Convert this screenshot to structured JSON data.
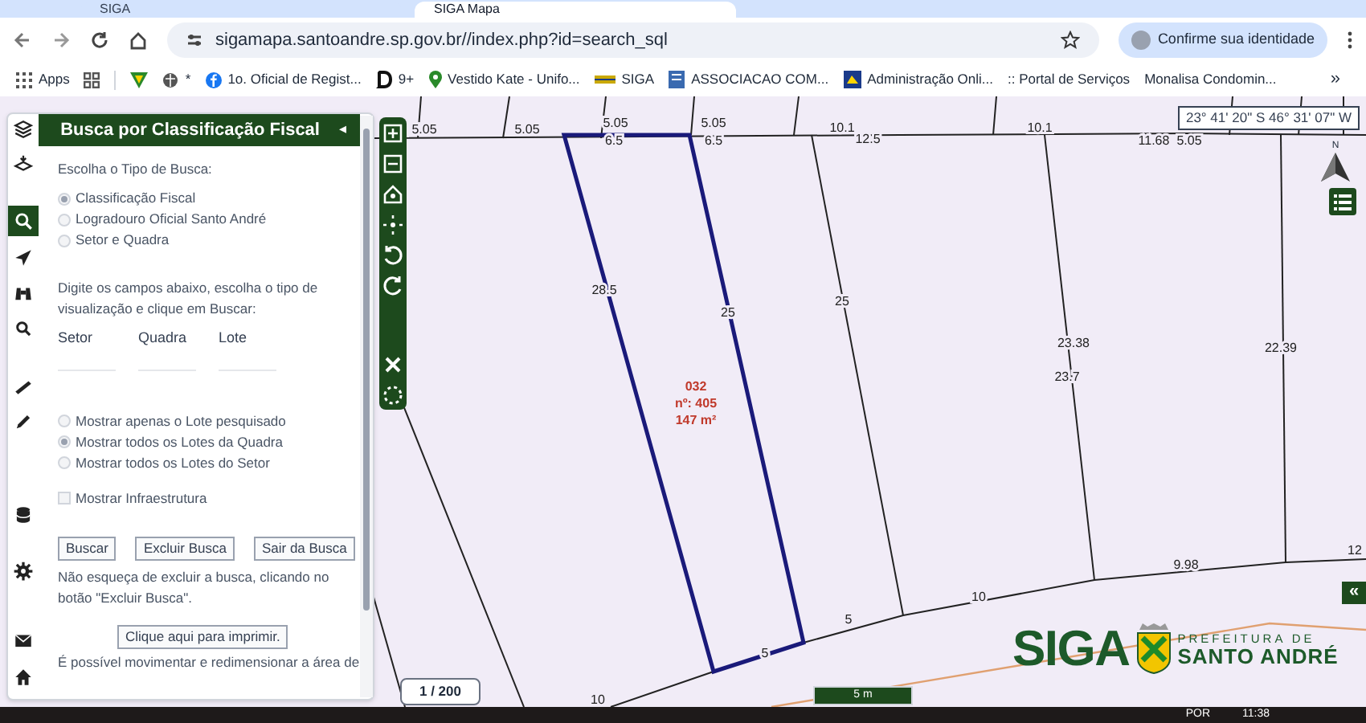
{
  "browser": {
    "tabs": [
      {
        "label": "SIGA",
        "selected": false
      },
      {
        "label": "SIGA Mapa",
        "selected": true
      }
    ],
    "url": "sigamapa.santoandre.sp.gov.br//index.php?id=search_sql",
    "profile_button": "Confirme sua identidade",
    "bookmarks": [
      {
        "label": "Apps"
      },
      {
        "label": "*"
      },
      {
        "label": "1o. Oficial de Regist..."
      },
      {
        "label": "9+"
      },
      {
        "label": "Vestido Kate - Unifo..."
      },
      {
        "label": "SIGA"
      },
      {
        "label": "ASSOCIACAO COM..."
      },
      {
        "label": "Administração Onli..."
      },
      {
        "label": ":: Portal de Serviços"
      },
      {
        "label": "Monalisa Condomin..."
      }
    ],
    "more": "»"
  },
  "sidebar": {
    "items": [
      {
        "selected": false
      },
      {
        "selected": false
      },
      {
        "selected": true
      },
      {
        "selected": false
      },
      {
        "selected": false
      },
      {
        "selected": false
      },
      {
        "selected": false
      },
      {
        "selected": false
      },
      {
        "selected": false
      },
      {
        "selected": false
      },
      {
        "selected": false
      },
      {
        "selected": false
      }
    ]
  },
  "panel": {
    "title": "Busca por Classificação Fiscal",
    "collapse": "◂",
    "search_type_label": "Escolha o Tipo de Busca:",
    "search_types": [
      {
        "label": "Classificação Fiscal",
        "selected": true
      },
      {
        "label": "Logradouro Oficial Santo André",
        "selected": false
      },
      {
        "label": "Setor e Quadra",
        "selected": false
      }
    ],
    "instructions": "Digite os campos abaixo, escolha o tipo de visualização e clique em Buscar:",
    "fields": [
      {
        "label": "Setor"
      },
      {
        "label": "Quadra"
      },
      {
        "label": "Lote"
      }
    ],
    "view_options": [
      {
        "label": "Mostrar apenas o Lote pesquisado",
        "selected": false
      },
      {
        "label": "Mostrar todos os Lotes da Quadra",
        "selected": true
      },
      {
        "label": "Mostrar todos os Lotes do Setor",
        "selected": false
      }
    ],
    "infrastructure": {
      "label": "Mostrar Infraestrutura",
      "checked": false
    },
    "buttons": [
      "Buscar",
      "Excluir Busca",
      "Sair da Busca"
    ],
    "note": "Não esqueça de excluir a busca, clicando no botão \"Excluir Busca\".",
    "print_button": "Clique aqui para imprimir.",
    "footer_note": "É possível movimentar e redimensionar a área de"
  },
  "map": {
    "coordinates": "23° 41' 20\" S 46° 31' 07\" W",
    "compass_label": "N",
    "measurements": [
      "5.05",
      "5.05",
      "5.05",
      "6.5",
      "5.05",
      "6.5",
      "10.1",
      "12.5",
      "10.1",
      "11.68",
      "5.05",
      "28.5",
      "25",
      "25",
      "23.38",
      "23.7",
      "22.39",
      "9.98",
      "10",
      "5",
      "5",
      "12",
      "10"
    ],
    "lot": [
      "032",
      "nº: 405",
      "147 m²"
    ],
    "scale": "1 / 200",
    "scale_bar": "5 m",
    "logo_text": "SIGA",
    "logo_sub1": "PREFEITURA DE",
    "logo_sub2": "SANTO ANDRÉ",
    "expand_button": "«"
  },
  "taskbar": {
    "language": "POR",
    "time": "11:38"
  }
}
